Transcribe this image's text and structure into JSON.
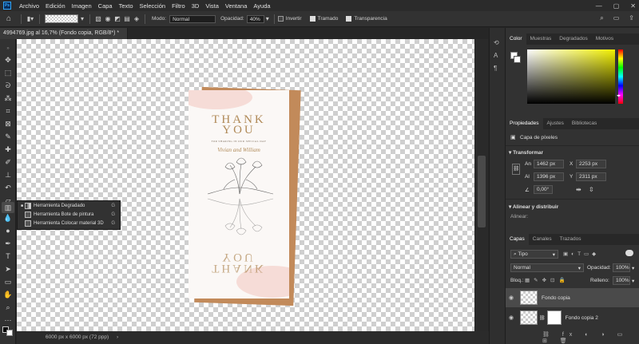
{
  "menubar": {
    "logo": "Ps",
    "items": [
      "Archivo",
      "Edición",
      "Imagen",
      "Capa",
      "Texto",
      "Selección",
      "Filtro",
      "3D",
      "Vista",
      "Ventana",
      "Ayuda"
    ]
  },
  "options": {
    "mode_label": "Modo:",
    "mode_value": "Normal",
    "opacity_label": "Opacidad:",
    "opacity_value": "40%",
    "invert_label": "Invertir",
    "dither_label": "Tramado",
    "transparency_label": "Transparencia"
  },
  "document": {
    "tab_title": "4994769.jpg al 16,7% (Fondo copia, RGB/8*) *",
    "status": "6000 px x 6000 px (72 ppp)"
  },
  "card": {
    "line1": "THANK",
    "line2": "YOU",
    "subtitle": "FOR SHARING IN OUR SPECIAL DAY",
    "names": "Vivian and William",
    "mirror_line1": "YOU",
    "mirror_line2": "THANK"
  },
  "tool_popup": {
    "items": [
      {
        "label": "Herramienta Degradado",
        "key": "G"
      },
      {
        "label": "Herramienta Bote de pintura",
        "key": "G"
      },
      {
        "label": "Herramienta Colocar material 3D",
        "key": "G"
      }
    ]
  },
  "color_panel": {
    "tabs": [
      "Color",
      "Muestras",
      "Degradados",
      "Motivos"
    ],
    "accent": "#f2f000"
  },
  "properties_panel": {
    "tabs": [
      "Propiedades",
      "Ajustes",
      "Bibliotecas"
    ],
    "layer_type": "Capa de píxeles",
    "transform_title": "Transformar",
    "w_label": "An",
    "w_value": "1462 px",
    "h_label": "Al",
    "h_value": "1396 px",
    "x_label": "X",
    "x_value": "2253 px",
    "y_label": "Y",
    "y_value": "2311 px",
    "angle": "0,00°",
    "align_title": "Alinear y distribuir",
    "align_sub": "Alinear:"
  },
  "layers_panel": {
    "tabs": [
      "Capas",
      "Canales",
      "Trazados"
    ],
    "filter": "Tipo",
    "blend": "Normal",
    "opacity_label": "Opacidad:",
    "opacity_value": "100%",
    "lock_label": "Bloq.:",
    "fill_label": "Relleno:",
    "fill_value": "100%",
    "layers": [
      {
        "name": "Fondo copia",
        "selected": true
      },
      {
        "name": "Fondo copia 2",
        "selected": false
      }
    ]
  }
}
